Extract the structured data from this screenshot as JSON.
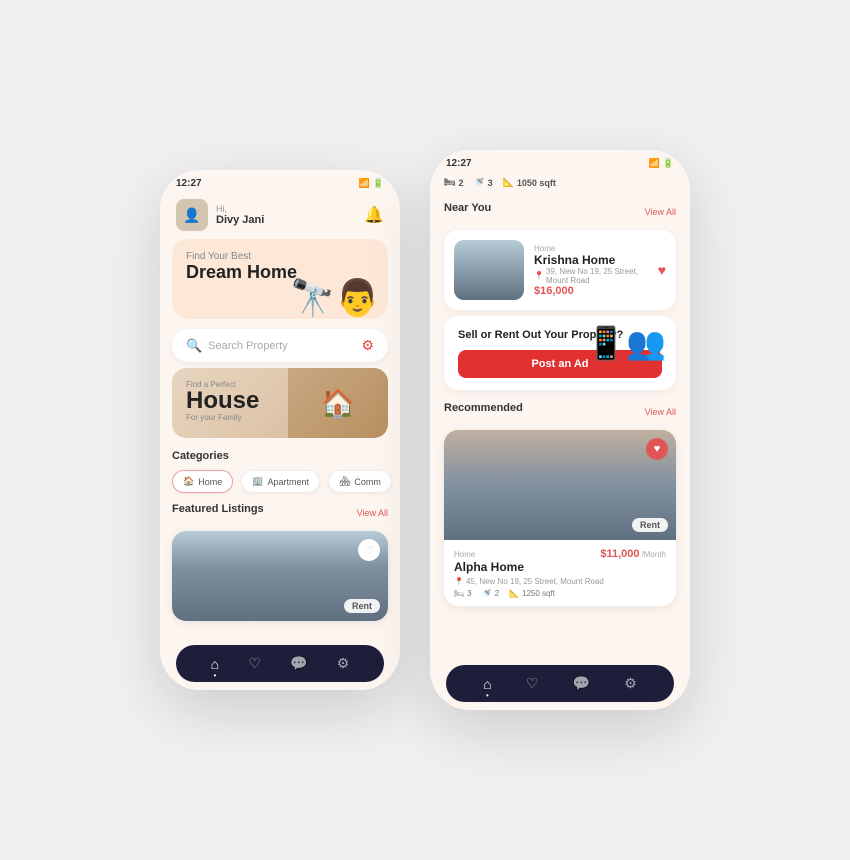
{
  "leftPhone": {
    "statusBar": {
      "time": "12:27",
      "icons": "●"
    },
    "header": {
      "greeting": "Hi,",
      "userName": "Divy Jani"
    },
    "hero": {
      "findText": "Find Your Best",
      "dreamHome": "Dream Home"
    },
    "search": {
      "placeholder": "Search Property"
    },
    "houseCard": {
      "findPerfect": "Find a Perfect",
      "houseLabel": "House",
      "forFamily": "For your Family"
    },
    "categories": {
      "title": "Categories",
      "items": [
        {
          "icon": "🏠",
          "label": "Home"
        },
        {
          "icon": "🏢",
          "label": "Apartment"
        },
        {
          "icon": "🏘",
          "label": "Comm"
        }
      ]
    },
    "featured": {
      "title": "Featured Listings",
      "viewAll": "View All",
      "rentBadge": "Rent"
    },
    "bottomNav": {
      "items": [
        "🏠",
        "♡",
        "💬",
        "⚙"
      ]
    }
  },
  "rightPhone": {
    "statusBar": {
      "time": "12:27"
    },
    "topStats": [
      {
        "icon": "🛏",
        "value": "2"
      },
      {
        "icon": "🚿",
        "value": "3"
      },
      {
        "icon": "📐",
        "value": "1050 sqft"
      }
    ],
    "nearYou": {
      "title": "Near You",
      "viewAll": "View All",
      "card": {
        "type": "Home",
        "name": "Krishna Home",
        "address": "39, New No 19, 25 Street, Mount Road",
        "price": "$16,000"
      }
    },
    "sellCard": {
      "title": "Sell or Rent Out Your Property?",
      "buttonLabel": "Post an Ad"
    },
    "recommended": {
      "title": "Recommended",
      "viewAll": "View All",
      "card": {
        "type": "Home",
        "name": "Alpha Home",
        "price": "$11,000",
        "period": "/Month",
        "address": "45, New No 19, 25 Street, Mount Road",
        "beds": "3",
        "baths": "2",
        "area": "1250 sqft",
        "rentBadge": "Rent"
      }
    },
    "bottomNav": {
      "items": [
        "🏠",
        "♡",
        "💬",
        "⚙"
      ]
    }
  }
}
